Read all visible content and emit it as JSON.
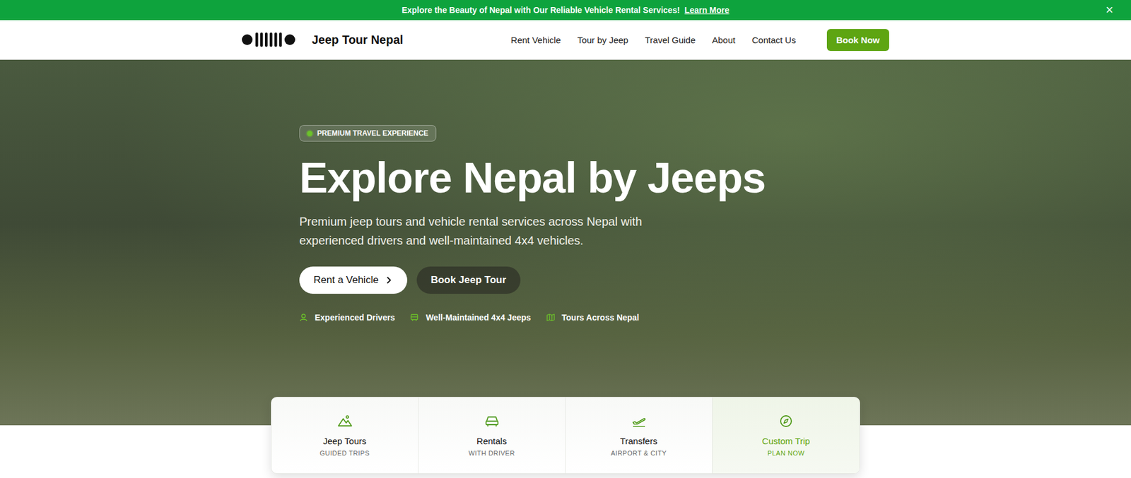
{
  "banner": {
    "text": "Explore the Beauty of Nepal with Our Reliable Vehicle Rental Services!",
    "link": "Learn More",
    "close": "×"
  },
  "brand": "Jeep Tour Nepal",
  "nav": [
    "Rent Vehicle",
    "Tour by Jeep",
    "Travel Guide",
    "About",
    "Contact Us"
  ],
  "book_button": "Book Now",
  "hero": {
    "badge": "PREMIUM TRAVEL EXPERIENCE",
    "title": "Explore Nepal by Jeeps",
    "subtitle": "Premium jeep tours and vehicle rental services across Nepal with experienced drivers and well-maintained 4x4 vehicles.",
    "primary_button": "Rent a Vehicle",
    "secondary_button": "Book Jeep Tour",
    "features": [
      {
        "label": "Experienced Drivers",
        "kind": "driver"
      },
      {
        "label": "Well-Maintained 4x4 Jeeps",
        "kind": "jeep"
      },
      {
        "label": "Tours Across Nepal",
        "kind": "map"
      }
    ]
  },
  "services": [
    {
      "title": "Jeep Tours",
      "subtitle": "GUIDED TRIPS",
      "kind": "mountain",
      "selected": false
    },
    {
      "title": "Rentals",
      "subtitle": "WITH DRIVER",
      "kind": "car",
      "selected": false
    },
    {
      "title": "Transfers",
      "subtitle": "AIRPORT & CITY",
      "kind": "plane",
      "selected": false
    },
    {
      "title": "Custom Trip",
      "subtitle": "PLAN NOW",
      "kind": "compass",
      "selected": true
    }
  ]
}
